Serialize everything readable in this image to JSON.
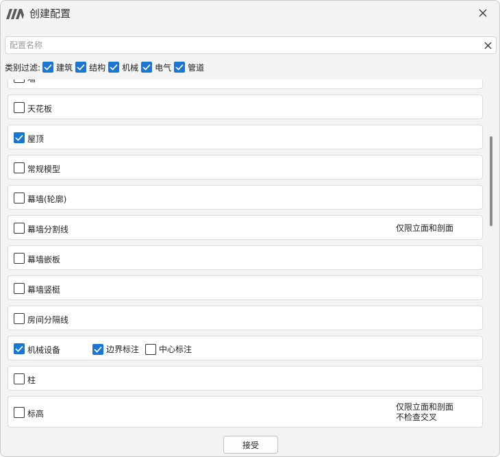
{
  "window": {
    "title": "创建配置",
    "accent_color": "#1976d2"
  },
  "search": {
    "placeholder": "配置名称",
    "value": ""
  },
  "filter": {
    "label": "类别过滤:",
    "items": [
      {
        "label": "建筑",
        "checked": true
      },
      {
        "label": "结构",
        "checked": true
      },
      {
        "label": "机械",
        "checked": true
      },
      {
        "label": "电气",
        "checked": true
      },
      {
        "label": "管道",
        "checked": true
      }
    ]
  },
  "categories": [
    {
      "label": "墙",
      "checked": false
    },
    {
      "label": "天花板",
      "checked": false
    },
    {
      "label": "屋顶",
      "checked": true
    },
    {
      "label": "常规模型",
      "checked": false
    },
    {
      "label": "幕墙(轮廓)",
      "checked": false
    },
    {
      "label": "幕墙分割线",
      "checked": false,
      "note": [
        "仅限立面和剖面"
      ]
    },
    {
      "label": "幕墙嵌板",
      "checked": false
    },
    {
      "label": "幕墙竖梃",
      "checked": false
    },
    {
      "label": "房间分隔线",
      "checked": false
    },
    {
      "label": "机械设备",
      "checked": true,
      "options": [
        {
          "label": "边界标注",
          "checked": true
        },
        {
          "label": "中心标注",
          "checked": false
        }
      ]
    },
    {
      "label": "柱",
      "checked": false
    },
    {
      "label": "标高",
      "checked": false,
      "note": [
        "仅限立面和剖面",
        "不检查交叉"
      ]
    }
  ],
  "footer": {
    "accept_label": "接受"
  }
}
